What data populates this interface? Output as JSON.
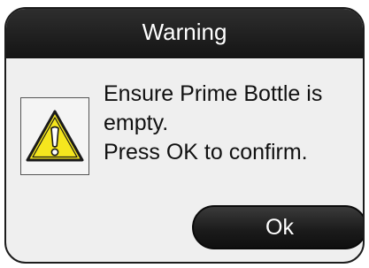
{
  "dialog": {
    "title": "Warning",
    "message_lines": [
      "Ensure Prime Bottle is",
      "empty.",
      "Press OK to confirm."
    ],
    "ok_label": "Ok",
    "icon": "warning-triangle-icon"
  },
  "colors": {
    "title_bar": "#1c1c1c",
    "dialog_bg": "#efefef",
    "warning_yellow": "#f5e61e",
    "button_bg": "#1a1a1a"
  }
}
